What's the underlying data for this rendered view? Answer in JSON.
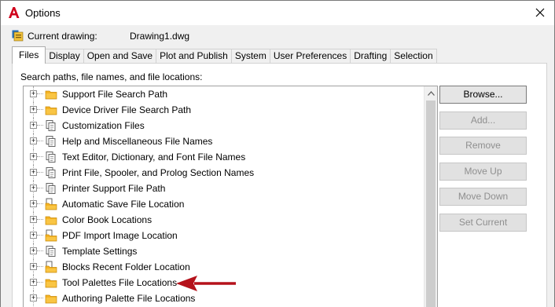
{
  "window": {
    "title": "Options",
    "close_icon": "close-icon",
    "app_icon": "autocad-a-icon"
  },
  "current_drawing": {
    "label": "Current drawing:",
    "value": "Drawing1.dwg"
  },
  "tabs": [
    {
      "label": "Files",
      "active": true
    },
    {
      "label": "Display"
    },
    {
      "label": "Open and Save"
    },
    {
      "label": "Plot and Publish"
    },
    {
      "label": "System"
    },
    {
      "label": "User Preferences"
    },
    {
      "label": "Drafting"
    },
    {
      "label": "Selection"
    }
  ],
  "files_panel": {
    "label": "Search paths, file names, and file locations:",
    "items": [
      {
        "label": "Support File Search Path",
        "icon": "folder-icon"
      },
      {
        "label": "Device Driver File Search Path",
        "icon": "folder-icon"
      },
      {
        "label": "Customization Files",
        "icon": "files-icon"
      },
      {
        "label": "Help and Miscellaneous File Names",
        "icon": "files-icon"
      },
      {
        "label": "Text Editor, Dictionary, and Font File Names",
        "icon": "files-icon"
      },
      {
        "label": "Print File, Spooler, and Prolog Section Names",
        "icon": "files-icon"
      },
      {
        "label": "Printer Support File Path",
        "icon": "files-icon"
      },
      {
        "label": "Automatic Save File Location",
        "icon": "folder-file-icon"
      },
      {
        "label": "Color Book Locations",
        "icon": "folder-icon"
      },
      {
        "label": "PDF Import Image Location",
        "icon": "folder-file-icon"
      },
      {
        "label": "Template Settings",
        "icon": "files-icon"
      },
      {
        "label": "Blocks Recent Folder Location",
        "icon": "folder-file-icon"
      },
      {
        "label": "Tool Palettes File Locations",
        "icon": "folder-icon"
      },
      {
        "label": "Authoring Palette File Locations",
        "icon": "folder-icon"
      }
    ]
  },
  "buttons": {
    "browse": "Browse...",
    "add": "Add...",
    "remove": "Remove",
    "move_up": "Move Up",
    "move_down": "Move Down",
    "set_current": "Set Current"
  },
  "annotation": {
    "arrow_color": "#b5121b",
    "points_to": "Tool Palettes File Locations"
  }
}
